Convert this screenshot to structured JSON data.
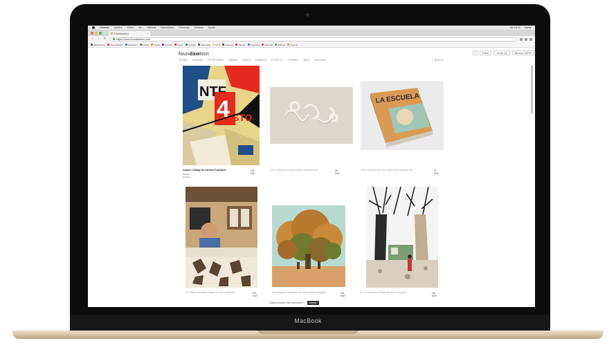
{
  "device": {
    "brand": "MacBook"
  },
  "mac_menubar": {
    "app": "Chrome",
    "items": [
      "Archivo",
      "Editar",
      "Ver",
      "Historial",
      "Marcadores",
      "Personas",
      "Ventana",
      "Ayuda"
    ],
    "status": [
      "Jue 18:03",
      "Marta"
    ]
  },
  "browser": {
    "tab_title": "Foundawtion",
    "url": "https://www.foundawtion.com"
  },
  "bookmarks": [
    {
      "label": "Aplicaciones",
      "color": "#555555"
    },
    {
      "label": "Comunicación",
      "color": "#e53935"
    },
    {
      "label": "Ilustración",
      "color": "#1e88e5"
    },
    {
      "label": "Diseño",
      "color": "#43a047"
    },
    {
      "label": "Tienda",
      "color": "#fb8c00"
    },
    {
      "label": "Noticias",
      "color": "#8e24aa"
    },
    {
      "label": "Correo",
      "color": "#e53935"
    },
    {
      "label": "Portfolio",
      "color": "#00897b"
    },
    {
      "label": "Calendario",
      "color": "#3949ab"
    },
    {
      "label": "Drive",
      "color": "#fdd835"
    },
    {
      "label": "Facturas",
      "color": "#6d4c41"
    },
    {
      "label": "Clientes",
      "color": "#d81b60"
    },
    {
      "label": "Proyectos",
      "color": "#1e88e5"
    },
    {
      "label": "Imprenta",
      "color": "#e53935"
    },
    {
      "label": "Galerías",
      "color": "#43a047"
    },
    {
      "label": "Museos",
      "color": "#fb8c00"
    }
  ],
  "site": {
    "logo_prefix": "foun",
    "logo_bold": "daw",
    "logo_suffix": "tion",
    "nav": [
      "Tienda",
      "Carteles",
      "Prints Marco",
      "Mapas",
      "Libros",
      "Cuadros",
      "Prints A3",
      "Postales",
      "Blog",
      "Nosotros"
    ],
    "search_label": "Buscar",
    "header_buttons": [
      "Entrar",
      "Carrito (0)",
      "Moneda: EUR €"
    ]
  },
  "products": [
    {
      "caption": "Cuadro: Collage de Carteles Populares",
      "sub": "Edición limitada",
      "price": "125 EUR",
      "colors": {
        "bg": "#e8d98a",
        "a": "#e52b1e",
        "b": "#1f4f86",
        "c": "#111111"
      }
    },
    {
      "caption": "LDP: Gofrado de Cinco Petalos. Ilustración de",
      "sub": "",
      "price": "35 EUR",
      "colors": {
        "bg": "#dcd6ce",
        "a": "#efeae4",
        "b": "#c9c3bb",
        "c": "#ffffff"
      }
    },
    {
      "caption": "Libro \"La ESCUELA\" de Tomas Mir. Ilustración de",
      "sub": "",
      "price": "20 EUR",
      "colors": {
        "bg": "#ebeaea",
        "a": "#d99a56",
        "b": "#9fc6b7",
        "c": "#2b2b2b"
      }
    },
    {
      "caption": "Eli: Niña en ventana. Dibujo de Pedro Redondo",
      "sub": "",
      "price": "150 EUR",
      "colors": {
        "bg": "#c6a57a",
        "a": "#7a5a3a",
        "b": "#e8e0cf",
        "c": "#2d2d2d"
      }
    },
    {
      "caption": "Eli: Naranjos y Palmeras. Dibujo de Pedro Redondo",
      "sub": "",
      "price": "150 EUR",
      "colors": {
        "bg": "#b6d8cf",
        "a": "#c88a3a",
        "b": "#6f7b2a",
        "c": "#d9a06a"
      }
    },
    {
      "caption": "Eli: Los Baobabs. Dibujo de Pedro Redondo",
      "sub": "",
      "price": "150 EUR",
      "colors": {
        "bg": "#f2f2f2",
        "a": "#2b2b2b",
        "b": "#bfae8f",
        "c": "#7c9e73"
      }
    }
  ],
  "cookie": {
    "text": "Usamos cookies. Más información",
    "accept": "Aceptar"
  }
}
